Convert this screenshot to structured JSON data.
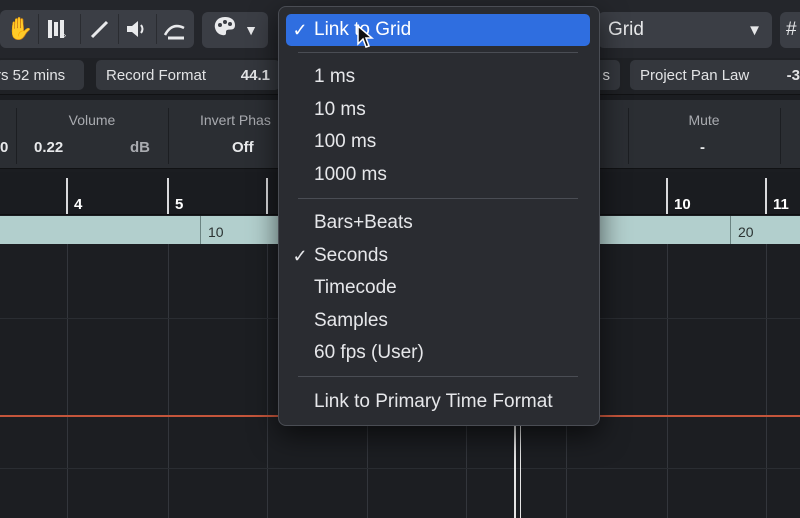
{
  "toolbar": {
    "snap_dropdown_value": "Grid",
    "snap_dropdown_arrow": "▼",
    "color_dropdown_arrow": "▼",
    "tools": [
      {
        "icon": "hand-icon",
        "glyph": "✋"
      },
      {
        "icon": "mute-tool-icon",
        "glyph": "▐"
      },
      {
        "icon": "pencil-icon",
        "glyph": "╱"
      },
      {
        "icon": "speaker-icon",
        "glyph": "🔈"
      },
      {
        "icon": "line-tool-icon",
        "glyph": "⤳"
      }
    ],
    "right_icon": "#"
  },
  "infoline": {
    "duration_fragment": "rs 52 mins",
    "record_format_label": "Record Format",
    "record_format_value": "44.1",
    "s_fragment": "s",
    "pan_law_label": "Project Pan Law",
    "pan_law_value": "-3"
  },
  "inspector": {
    "left_value": "0",
    "volume_label": "Volume",
    "volume_value": "0.22",
    "volume_unit": "dB",
    "invert_phase_label": "Invert Phas",
    "invert_phase_value": "Off",
    "mute_label": "Mute",
    "mute_value": "-"
  },
  "ruler": {
    "bars": [
      "4",
      "5",
      "10",
      "11"
    ],
    "seconds": [
      "10",
      "20"
    ]
  },
  "menu": {
    "items": [
      {
        "label": "Link to Grid",
        "checked": true,
        "selected": true
      },
      {
        "label": "1 ms"
      },
      {
        "label": "10 ms"
      },
      {
        "label": "100 ms"
      },
      {
        "label": "1000 ms"
      },
      {
        "label": "Bars+Beats"
      },
      {
        "label": "Seconds",
        "checked": true
      },
      {
        "label": "Timecode"
      },
      {
        "label": "Samples"
      },
      {
        "label": "60 fps (User)"
      },
      {
        "label": "Link to Primary Time Format"
      }
    ],
    "check_glyph": "✓"
  },
  "colors": {
    "menu_highlight": "#2f6ee0",
    "playline": "#c4553b",
    "timeline_band": "#b2cfcd"
  }
}
